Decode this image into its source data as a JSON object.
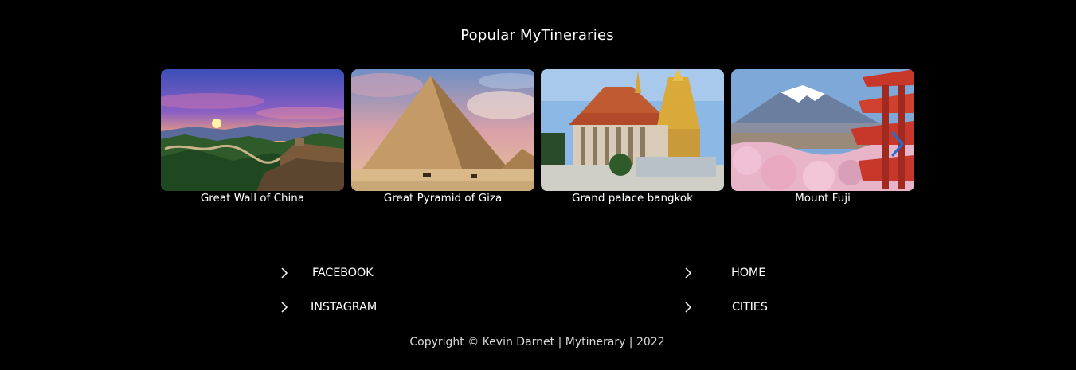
{
  "popular": {
    "title": "Popular MyTineraries",
    "cards": [
      {
        "caption": "Great Wall of China",
        "image": "great-wall-photo"
      },
      {
        "caption": "Great Pyramid of Giza",
        "image": "pyramid-photo"
      },
      {
        "caption": "Grand palace bangkok",
        "image": "grand-palace-photo"
      },
      {
        "caption": "Mount Fuji",
        "image": "mount-fuji-photo"
      }
    ],
    "next_icon": "chevron-right-icon"
  },
  "footer": {
    "social": [
      {
        "label": "FACEBOOK",
        "icon": "chevron-right-icon"
      },
      {
        "label": "INSTAGRAM",
        "icon": "chevron-right-icon"
      }
    ],
    "nav": [
      {
        "label": "HOME",
        "icon": "chevron-right-icon"
      },
      {
        "label": "CITIES",
        "icon": "chevron-right-icon"
      }
    ],
    "copyright": "Copyright © Kevin Darnet | Mytinerary | 2022"
  },
  "colors": {
    "background": "#000000",
    "text": "#ffffff",
    "carousel_arrow": "#1e6fd9"
  }
}
